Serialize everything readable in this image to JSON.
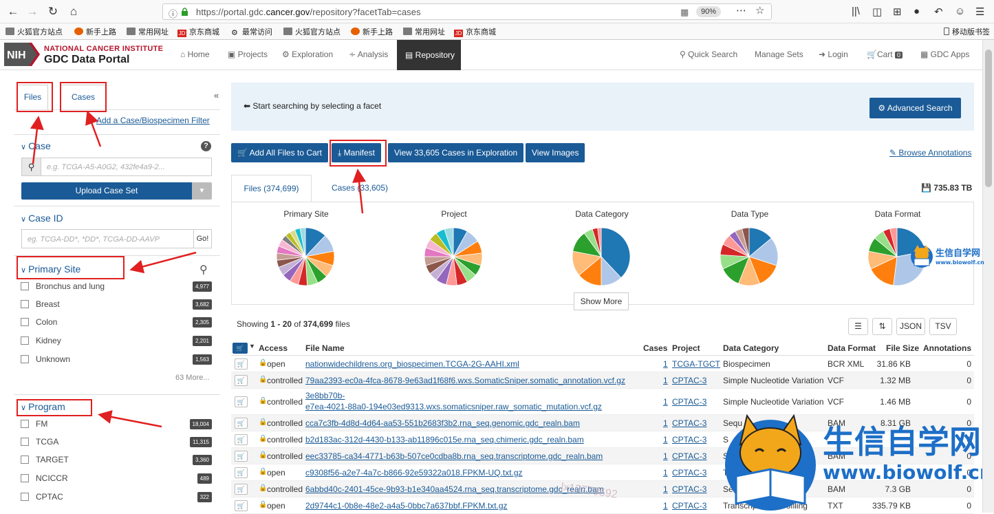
{
  "browser": {
    "url_prefix": "https://portal.gdc.",
    "url_domain": "cancer.gov",
    "url_path": "/repository?facetTab=cases",
    "zoom": "90%"
  },
  "bookmarks": [
    {
      "label": "火狐官方站点",
      "icon": "folder-icon"
    },
    {
      "label": "新手上路",
      "icon": "firefox-icon"
    },
    {
      "label": "常用网址",
      "icon": "folder-icon"
    },
    {
      "label": "京东商城",
      "icon": "jd-icon"
    },
    {
      "label": "最常访问",
      "icon": "gear-icon"
    },
    {
      "label": "火狐官方站点",
      "icon": "folder-icon"
    },
    {
      "label": "新手上路",
      "icon": "firefox-icon"
    },
    {
      "label": "常用网址",
      "icon": "folder-icon"
    },
    {
      "label": "京东商城",
      "icon": "jd-icon"
    }
  ],
  "mobile_bookmarks": "移动版书签",
  "header": {
    "nih": "NIH",
    "nci_title": "NATIONAL CANCER INSTITUTE",
    "portal_title": "GDC Data Portal",
    "nav": {
      "home": "Home",
      "projects": "Projects",
      "exploration": "Exploration",
      "analysis": "Analysis",
      "repository": "Repository",
      "quick_search": "Quick Search",
      "manage_sets": "Manage Sets",
      "login": "Login",
      "cart": "Cart",
      "cart_count": "0",
      "gdc_apps": "GDC Apps"
    }
  },
  "sidebar": {
    "tab_files": "Files",
    "tab_cases": "Cases",
    "collapse": "«",
    "add_filter": "Add a Case/Biospecimen Filter",
    "case_facet": {
      "title": "Case",
      "placeholder": "e.g. TCGA-A5-A0G2, 432fe4a9-2...",
      "upload": "Upload Case Set"
    },
    "case_id_facet": {
      "title": "Case ID",
      "placeholder": "eg. TCGA-DD*, *DD*, TCGA-DD-AAVP",
      "go": "Go!"
    },
    "primary_site": {
      "title": "Primary Site",
      "items": [
        {
          "label": "Bronchus and lung",
          "count": "4,977"
        },
        {
          "label": "Breast",
          "count": "3,682"
        },
        {
          "label": "Colon",
          "count": "2,305"
        },
        {
          "label": "Kidney",
          "count": "2,201"
        },
        {
          "label": "Unknown",
          "count": "1,563"
        }
      ],
      "more": "63 More..."
    },
    "program": {
      "title": "Program",
      "items": [
        {
          "label": "FM",
          "count": "18,004"
        },
        {
          "label": "TCGA",
          "count": "11,315"
        },
        {
          "label": "TARGET",
          "count": "3,360"
        },
        {
          "label": "NCICCR",
          "count": "489"
        },
        {
          "label": "CPTAC",
          "count": "322"
        }
      ]
    }
  },
  "main": {
    "info": "Start searching by selecting a facet",
    "advanced_search": "Advanced Search",
    "actions": {
      "add_all": "Add All Files to Cart",
      "manifest": "Manifest",
      "view_cases": "View 33,605 Cases in Exploration",
      "view_images": "View Images"
    },
    "browse_annotations": "Browse Annotations",
    "tabs": {
      "files": "Files (374,699)",
      "cases": "Cases (33,605)"
    },
    "total_size": "735.83 TB",
    "pies": [
      {
        "title": "Primary Site"
      },
      {
        "title": "Project"
      },
      {
        "title": "Data Category"
      },
      {
        "title": "Data Type"
      },
      {
        "title": "Data Format"
      }
    ],
    "show_more": "Show More",
    "showing": {
      "prefix": "Showing ",
      "range": "1 - 20",
      "of": " of ",
      "total": "374,699",
      "suffix": " files"
    },
    "controls": {
      "json": "JSON",
      "tsv": "TSV"
    },
    "columns": {
      "access": "Access",
      "file_name": "File Name",
      "cases": "Cases",
      "project": "Project",
      "data_category": "Data Category",
      "data_format": "Data Format",
      "file_size": "File Size",
      "annotations": "Annotations"
    },
    "rows": [
      {
        "access": "open",
        "file": "nationwidechildrens.org_biospecimen.TCGA-2G-AAHI.xml",
        "file2": "",
        "cases": "1",
        "project": "TCGA-TGCT",
        "category": "Biospecimen",
        "format": "BCR XML",
        "size": "31.86 KB",
        "ann": "0"
      },
      {
        "access": "controlled",
        "file": "79aa2393-ec0a-4fca-8678-9e63ad1f68f6.wxs.SomaticSniper.somatic_annotation.vcf.gz",
        "file2": "",
        "cases": "1",
        "project": "CPTAC-3",
        "category": "Simple Nucleotide Variation",
        "format": "VCF",
        "size": "1.32 MB",
        "ann": "0"
      },
      {
        "access": "controlled",
        "file": "3e8bb70b-",
        "file2": "e7ea-4021-88a0-194e03ed9313.wxs.somaticsniper.raw_somatic_mutation.vcf.gz",
        "cases": "1",
        "project": "CPTAC-3",
        "category": "Simple Nucleotide Variation",
        "format": "VCF",
        "size": "1.46 MB",
        "ann": "0"
      },
      {
        "access": "controlled",
        "file": "cca7c3fb-4d8d-4d64-aa53-551b2683f3b2.rna_seq.genomic.gdc_realn.bam",
        "file2": "",
        "cases": "1",
        "project": "CPTAC-3",
        "category": "Sequ",
        "format": "BAM",
        "size": "8.31 GB",
        "ann": "0"
      },
      {
        "access": "controlled",
        "file": "b2d183ac-312d-4430-b133-ab11896c015e.rna_seq.chimeric.gdc_realn.bam",
        "file2": "",
        "cases": "1",
        "project": "CPTAC-3",
        "category": "S",
        "format": "",
        "size": "",
        "ann": "0"
      },
      {
        "access": "controlled",
        "file": "eec33785-ca34-4771-b63b-507ce0cdba8b.rna_seq.transcriptome.gdc_realn.bam",
        "file2": "",
        "cases": "1",
        "project": "CPTAC-3",
        "category": "S",
        "format": "BAM",
        "size": "",
        "ann": "0"
      },
      {
        "access": "open",
        "file": "c9308f56-a2e7-4a7c-b866-92e59322a018.FPKM-UQ.txt.gz",
        "file2": "",
        "cases": "1",
        "project": "CPTAC-3",
        "category": "Tra",
        "format": "",
        "size": "",
        "ann": "0"
      },
      {
        "access": "controlled",
        "file": "6abbd40c-2401-45ce-9b93-b1e340aa4524.rna_seq.transcriptome.gdc_realn.bam",
        "file2": "",
        "cases": "1",
        "project": "CPTAC-3",
        "category": "Seque",
        "format": "BAM",
        "size": "7.3 GB",
        "ann": "0"
      },
      {
        "access": "open",
        "file": "2d9744c1-0b8e-48e2-a4a5-0bbc7a637bbf.FPKM.txt.gz",
        "file2": "",
        "cases": "1",
        "project": "CPTAC-3",
        "category": "Transcriptome Profiling",
        "format": "TXT",
        "size": "335.79 KB",
        "ann": "0"
      }
    ]
  },
  "watermark": {
    "small_cn": "生信自学网",
    "small_url": "www.biowolf.cn",
    "big_cn": "生信自学网",
    "big_url": "www.biowolf.cn",
    "overlay_text": "lx13779592"
  }
}
